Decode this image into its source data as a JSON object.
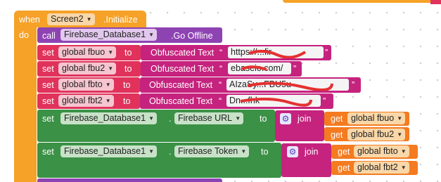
{
  "when_block": {
    "when_label": "when",
    "component": "Screen2",
    "event": ".Initialize",
    "do_label": "do"
  },
  "call_block": {
    "call_label": "call",
    "component": "Firebase_Database1",
    "method": ".Go Offline"
  },
  "set_globals": [
    {
      "set_label": "set",
      "variable": "global fbuo",
      "to_label": "to",
      "text_label": "Obfuscated Text",
      "value": "https://...fir"
    },
    {
      "set_label": "set",
      "variable": "global fbu2",
      "to_label": "to",
      "text_label": "Obfuscated Text",
      "value": "ebaseio.com/"
    },
    {
      "set_label": "set",
      "variable": "global fbto",
      "to_label": "to",
      "text_label": "Obfuscated Text",
      "value": "AIzaSy...FBU5u"
    },
    {
      "set_label": "set",
      "variable": "global fbt2",
      "to_label": "to",
      "text_label": "Obfuscated Text",
      "value": "Dn...fhk"
    }
  ],
  "set_props": [
    {
      "set_label": "set",
      "component": "Firebase_Database1",
      "property": "Firebase URL",
      "to_label": "to",
      "join_label": "join",
      "gets": [
        {
          "get_label": "get",
          "variable": "global fbuo"
        },
        {
          "get_label": "get",
          "variable": "global fbu2"
        }
      ]
    },
    {
      "set_label": "set",
      "component": "Firebase_Database1",
      "property": "Firebase Token",
      "to_label": "to",
      "join_label": "join",
      "gets": [
        {
          "get_label": "get",
          "variable": "global fbto"
        },
        {
          "get_label": "get",
          "variable": "global fbt2"
        }
      ]
    }
  ],
  "icons": {
    "dropdown": "dropdown-arrow-icon",
    "mutator": "gear-icon"
  },
  "colors": {
    "event_orange": "#f6a127",
    "component_purple": "#8e43b3",
    "variable_pink": "#e0325b",
    "text_magenta": "#c5237e",
    "component_green": "#3b9146",
    "get_orange": "#f47b20"
  }
}
